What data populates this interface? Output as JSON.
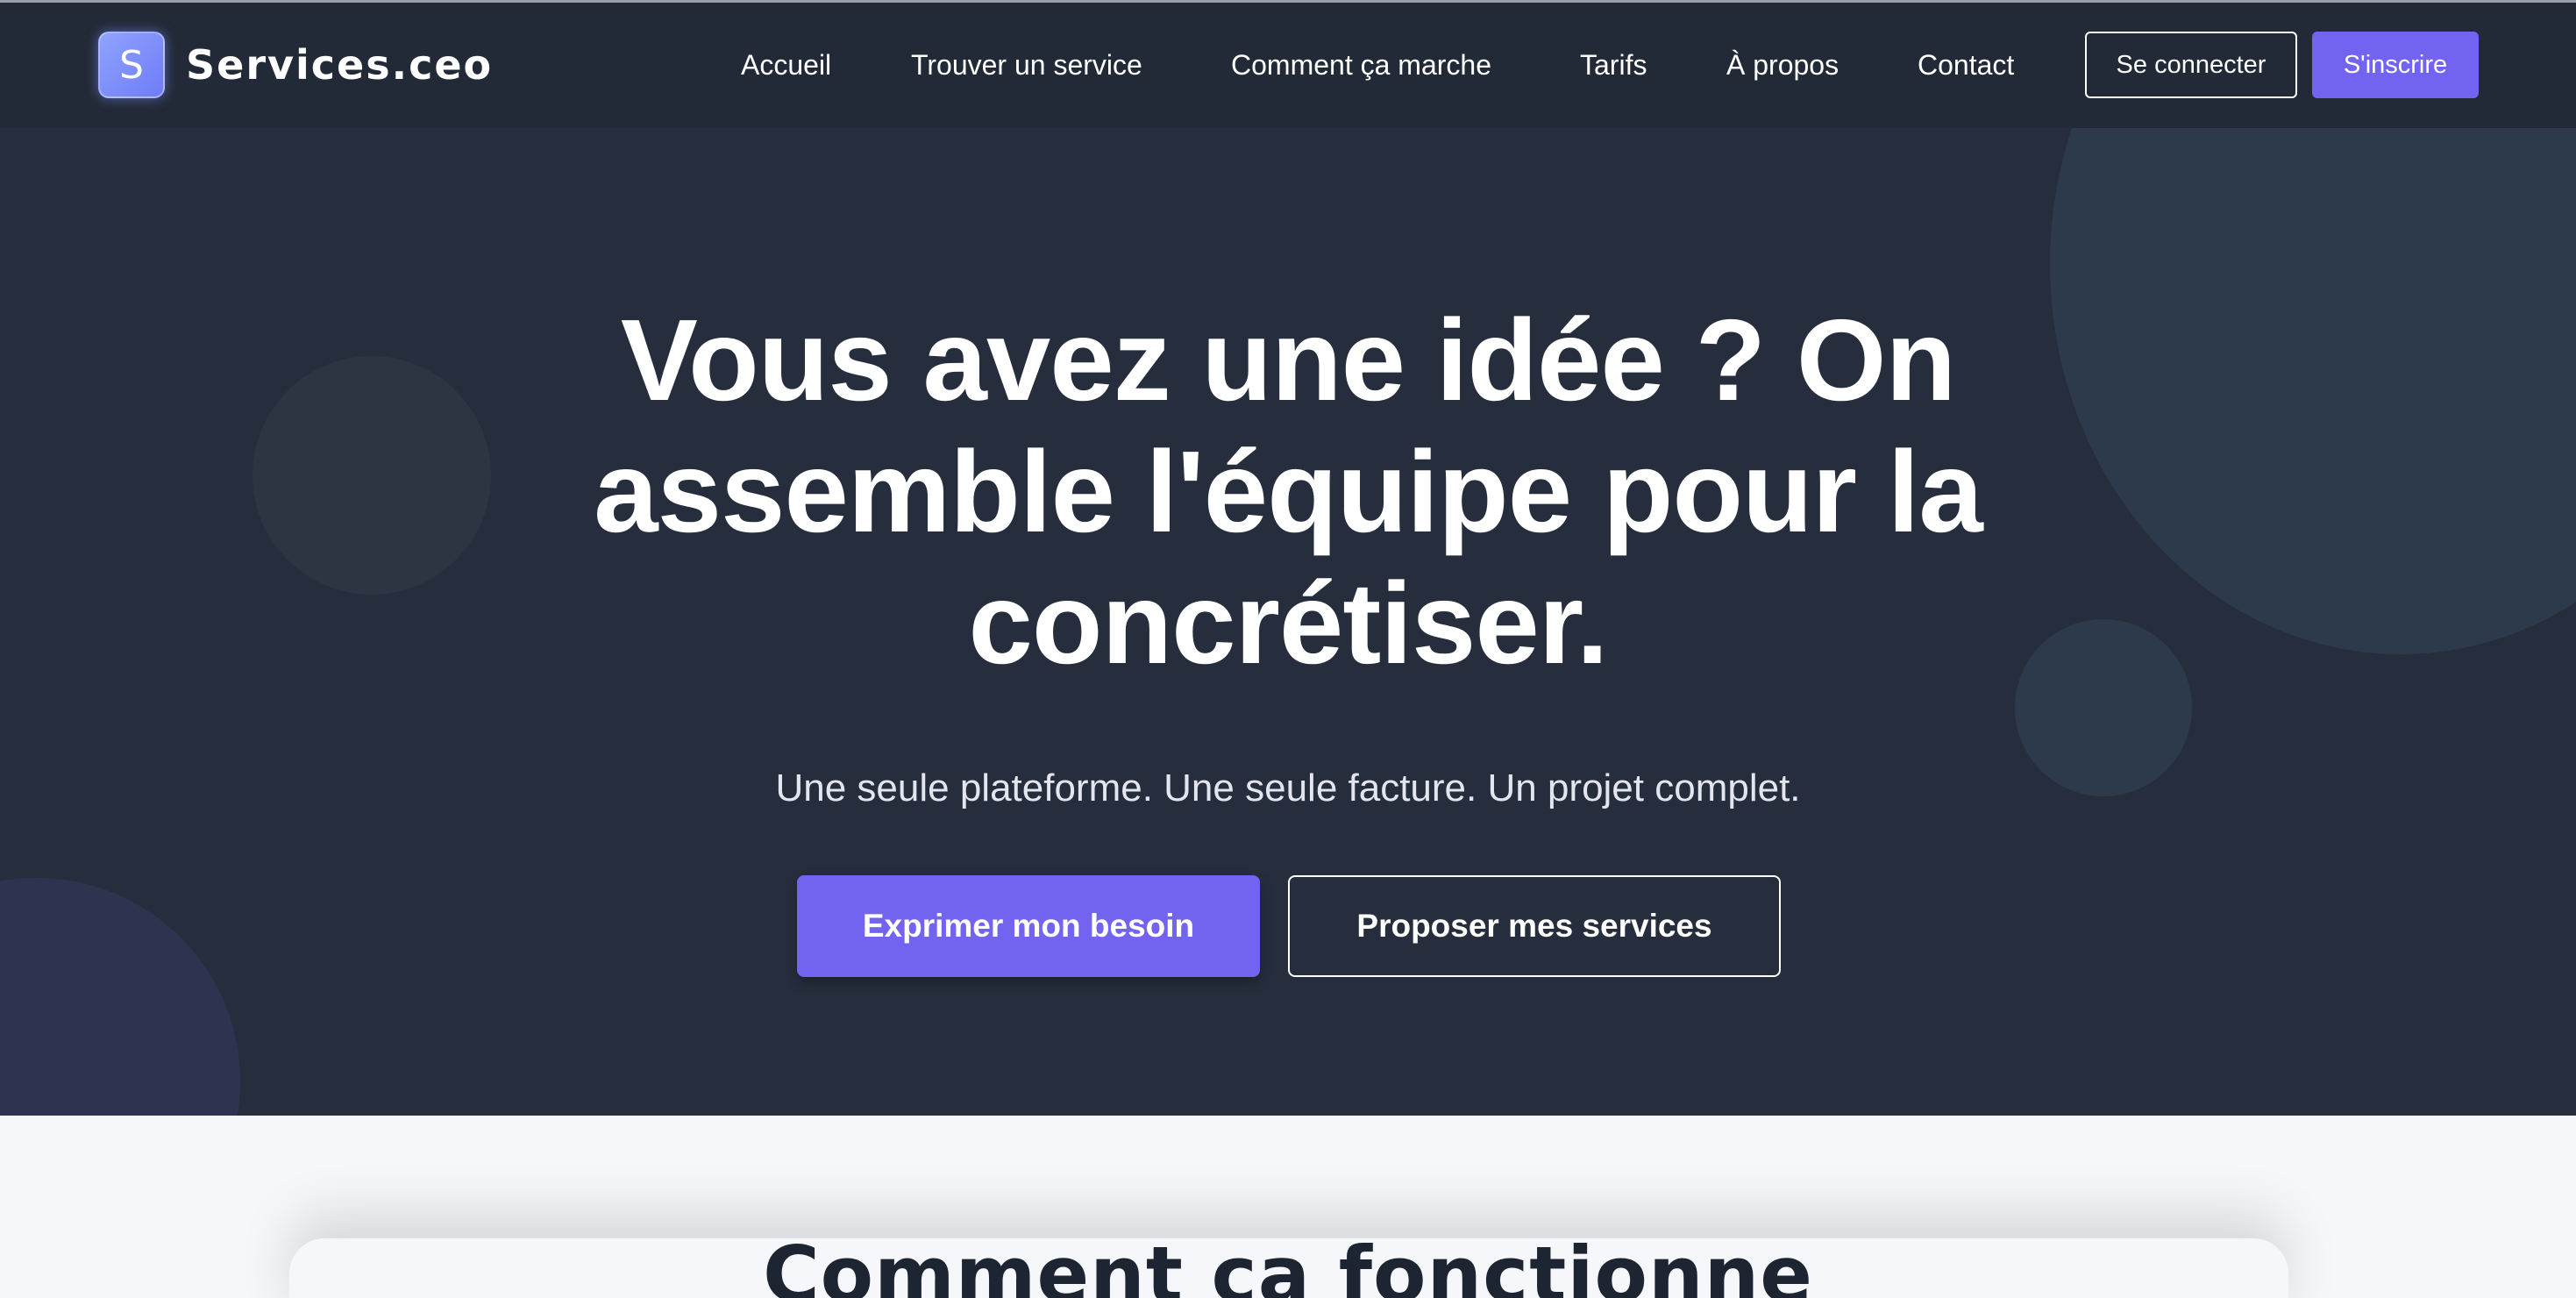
{
  "brand": {
    "logo_letter": "S",
    "name": "Services.ceo",
    "accent_color": "#7263f0"
  },
  "nav": {
    "links": [
      {
        "label": "Accueil"
      },
      {
        "label": "Trouver un service"
      },
      {
        "label": "Comment ça marche"
      },
      {
        "label": "Tarifs"
      },
      {
        "label": "À propos"
      },
      {
        "label": "Contact"
      }
    ],
    "login_label": "Se connecter",
    "signup_label": "S'inscrire"
  },
  "hero": {
    "title_line1": "Vous avez une idée ? On",
    "title_line2": "assemble l'équipe pour la",
    "title_line3": "concrétiser.",
    "subtitle": "Une seule plateforme. Une seule facture. Un projet complet.",
    "primary_cta": "Exprimer mon besoin",
    "secondary_cta": "Proposer mes services"
  },
  "how_it_works": {
    "title": "Comment ça fonctionne"
  }
}
